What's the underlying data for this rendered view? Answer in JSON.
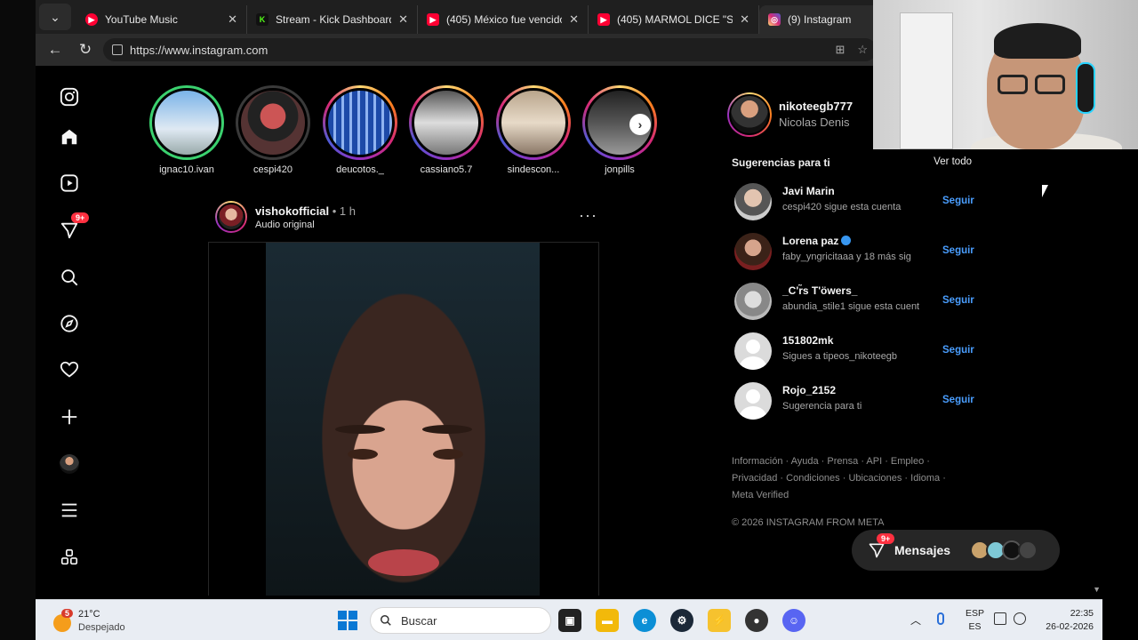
{
  "browser": {
    "tabs": [
      {
        "title": "YouTube Music",
        "color": "#ff0033",
        "active": false
      },
      {
        "title": "Stream - Kick Dashboard",
        "color": "#53fc18",
        "active": false
      },
      {
        "title": "(405) México fue vencido po",
        "color": "#ff0033",
        "active": false
      },
      {
        "title": "(405) MARMOL DICE \"SI\" A",
        "color": "#ff0033",
        "active": false
      },
      {
        "title": "(9) Instagram",
        "color": "#d62976",
        "active": true
      }
    ],
    "url": "https://www.instagram.com"
  },
  "stories": [
    {
      "name": "ignac10.ivan",
      "ring": "close"
    },
    {
      "name": "cespi420",
      "ring": "seen"
    },
    {
      "name": "deucotos._",
      "ring": "grad"
    },
    {
      "name": "cassiano5.7",
      "ring": "grad"
    },
    {
      "name": "sindescon...",
      "ring": "grad"
    },
    {
      "name": "jonpills",
      "ring": "grad"
    }
  ],
  "nav": {
    "notifications_badge": "9+"
  },
  "post": {
    "user": "vishokofficial",
    "time": " • 1 h",
    "audio": "Audio original",
    "more": "···"
  },
  "profile": {
    "username": "nikoteegb777",
    "fullname": "Nicolas Denis"
  },
  "suggestions": {
    "title": "Sugerencias para ti",
    "see_all": "Ver todo",
    "items": [
      {
        "user": "Javi Marin",
        "sub": "cespi420 sigue esta cuenta",
        "follow": "Seguir",
        "verified": false
      },
      {
        "user": "Lorena paz",
        "sub": "faby_yngricitaaa y 18 más sig",
        "follow": "Seguir",
        "verified": true
      },
      {
        "user": "_C'r̃s T'öwers_",
        "sub": "abundia_stile1 sigue esta cuent",
        "follow": "Seguir",
        "verified": false
      },
      {
        "user": "151802mk",
        "sub": "Sigues a tipeos_nikoteegb",
        "follow": "Seguir",
        "verified": false
      },
      {
        "user": "Rojo_2152",
        "sub": "Sugerencia para ti",
        "follow": "Seguir",
        "verified": false
      }
    ]
  },
  "footer": {
    "line1": "Información · Ayuda · Prensa · API · Empleo ·",
    "line2": "Privacidad · Condiciones · Ubicaciones · Idioma ·",
    "line3": "Meta Verified",
    "copyright": "© 2026 INSTAGRAM FROM META"
  },
  "messages": {
    "label": "Mensajes",
    "badge": "9+"
  },
  "taskbar": {
    "weather_badge": "5",
    "temp": "21°C",
    "condition": "Despejado",
    "search_placeholder": "Buscar",
    "lang1": "ESP",
    "lang2": "ES",
    "time": "22:35",
    "date": "26-02-2026"
  }
}
